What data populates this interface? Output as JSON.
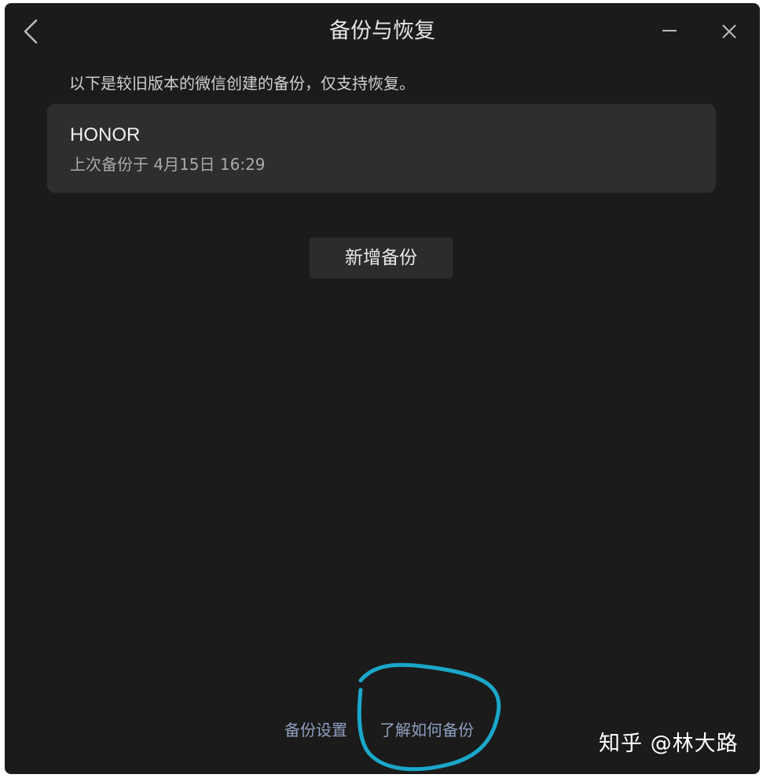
{
  "window": {
    "title": "备份与恢复",
    "back_icon": "chevron-left-icon",
    "minimize_icon": "minimize-icon",
    "close_icon": "close-icon"
  },
  "notice": "以下是较旧版本的微信创建的备份，仅支持恢复。",
  "backups": [
    {
      "device": "HONOR",
      "last_backup": "上次备份于 4月15日 16:29"
    }
  ],
  "actions": {
    "new_backup": "新增备份"
  },
  "footer": {
    "settings": "备份设置",
    "learn_how": "了解如何备份"
  },
  "annotation": {
    "color": "#1aa7c9"
  },
  "watermark": "知乎 @林大路",
  "colors": {
    "background": "#1b1b1b",
    "card": "#2e2e2e",
    "button": "#2c2c2c",
    "link": "#8f9fc0"
  }
}
